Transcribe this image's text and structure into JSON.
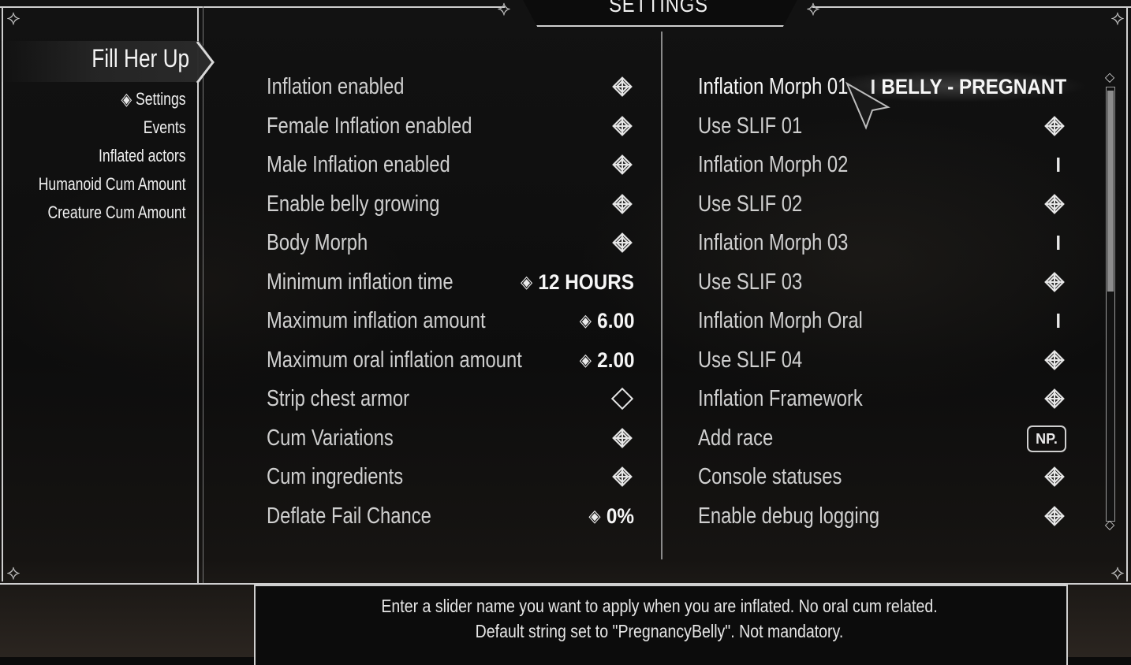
{
  "window": {
    "title": "SETTINGS"
  },
  "mod": {
    "title": "Fill Her Up"
  },
  "pages": [
    {
      "label": "Settings",
      "selected": true
    },
    {
      "label": "Events",
      "selected": false
    },
    {
      "label": "Inflated actors",
      "selected": false
    },
    {
      "label": "Humanoid Cum Amount",
      "selected": false
    },
    {
      "label": "Creature Cum Amount",
      "selected": false
    }
  ],
  "left_options": [
    {
      "label": "Inflation enabled",
      "type": "toggle",
      "checked": true
    },
    {
      "label": "Female Inflation enabled",
      "type": "toggle",
      "checked": true
    },
    {
      "label": "Male Inflation enabled",
      "type": "toggle",
      "checked": true
    },
    {
      "label": "Enable belly growing",
      "type": "toggle",
      "checked": true
    },
    {
      "label": "Body Morph",
      "type": "toggle",
      "checked": true
    },
    {
      "label": "Minimum inflation time",
      "type": "slider",
      "value": "12 HOURS"
    },
    {
      "label": "Maximum inflation amount",
      "type": "slider",
      "value": "6.00"
    },
    {
      "label": "Maximum oral inflation amount",
      "type": "slider",
      "value": "2.00"
    },
    {
      "label": "Strip chest armor",
      "type": "toggle",
      "checked": false
    },
    {
      "label": "Cum Variations",
      "type": "toggle",
      "checked": true
    },
    {
      "label": "Cum ingredients",
      "type": "toggle",
      "checked": true
    },
    {
      "label": "Deflate Fail Chance",
      "type": "slider",
      "value": "0%"
    }
  ],
  "right_options": [
    {
      "label": "Inflation Morph 01",
      "type": "input",
      "value": "BELLY - PREGNANT",
      "highlighted": true
    },
    {
      "label": "Use SLIF 01",
      "type": "toggle",
      "checked": true
    },
    {
      "label": "Inflation Morph 02",
      "type": "input",
      "value": ""
    },
    {
      "label": "Use SLIF 02",
      "type": "toggle",
      "checked": true
    },
    {
      "label": "Inflation Morph 03",
      "type": "input",
      "value": ""
    },
    {
      "label": "Use SLIF 03",
      "type": "toggle",
      "checked": true
    },
    {
      "label": "Inflation Morph Oral",
      "type": "input",
      "value": ""
    },
    {
      "label": "Use SLIF 04",
      "type": "toggle",
      "checked": true
    },
    {
      "label": "Inflation Framework",
      "type": "toggle",
      "checked": true
    },
    {
      "label": "Add race",
      "type": "keymap",
      "value": "NP."
    },
    {
      "label": "Console statuses",
      "type": "toggle",
      "checked": true
    },
    {
      "label": "Enable debug logging",
      "type": "toggle",
      "checked": true
    }
  ],
  "info": {
    "line1": "Enter a slider name you want to apply when you are inflated. No oral cum related.",
    "line2": "Default string set to \"PregnancyBelly\". Not mandatory."
  },
  "icons": {
    "checked": "knot-checkbox-checked-icon",
    "unchecked": "diamond-checkbox-empty-icon",
    "slider": "slider-arrows-icon",
    "input": "text-cursor-icon",
    "selected_page": "knot-selector-icon",
    "pointer": "mouse-pointer-icon"
  },
  "colors": {
    "frame": "#cfcfcf",
    "text": "#cfcfcf",
    "value": "#f6f6f6",
    "background": "#0b0b0b"
  }
}
